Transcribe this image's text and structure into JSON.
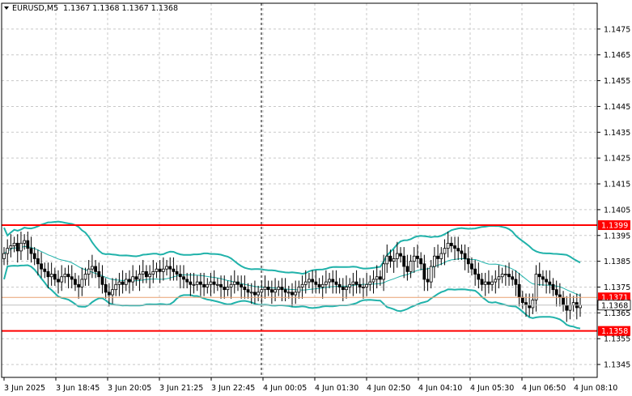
{
  "header": {
    "symbol": "EURUSD,M5",
    "ohlc": "1.1367 1.1368 1.1367 1.1368"
  },
  "colors": {
    "background": "#ffffff",
    "grid": "#c8c8c8",
    "axis": "#000000",
    "candle": "#000000",
    "bands": "#20b2aa",
    "level_line": "#ff0000",
    "bid_line": "#e8a070",
    "tag_red": "#ff0000"
  },
  "chart_data": {
    "type": "candlestick",
    "title": "EURUSD,M5",
    "ylim": [
      1.134,
      1.1485
    ],
    "y_ticks": [
      "1.1475",
      "1.1465",
      "1.1455",
      "1.1445",
      "1.1435",
      "1.1425",
      "1.1415",
      "1.1405",
      "1.1395",
      "1.1385",
      "1.1375",
      "1.1365",
      "1.1355",
      "1.1345"
    ],
    "x_ticks": [
      "3 Jun 2025",
      "3 Jun 18:45",
      "3 Jun 20:05",
      "3 Jun 21:25",
      "3 Jun 22:45",
      "4 Jun 00:05",
      "4 Jun 01:30",
      "4 Jun 02:50",
      "4 Jun 04:10",
      "4 Jun 05:30",
      "4 Jun 06:50",
      "4 Jun 08:10"
    ],
    "session_separator": "4 Jun 00:05",
    "levels": [
      {
        "label": "1.1399",
        "value": 1.1399
      },
      {
        "label": "1.1358",
        "value": 1.1358
      }
    ],
    "price_tags": [
      {
        "label": "1.1371",
        "value": 1.1371
      },
      {
        "label": "1.1368",
        "value": 1.1368
      }
    ],
    "close": [
      1.1388,
      1.139,
      1.1391,
      1.1392,
      1.1389,
      1.1392,
      1.1393,
      1.139,
      1.1388,
      1.1386,
      1.1384,
      1.1382,
      1.1381,
      1.1379,
      1.138,
      1.1378,
      1.1377,
      1.1379,
      1.138,
      1.1379,
      1.1378,
      1.1376,
      1.1375,
      1.1378,
      1.138,
      1.1382,
      1.1383,
      1.1381,
      1.1379,
      1.1376,
      1.1373,
      1.1372,
      1.1374,
      1.1376,
      1.1377,
      1.1376,
      1.1378,
      1.1377,
      1.1379,
      1.1378,
      1.138,
      1.1381,
      1.1379,
      1.138,
      1.1381,
      1.1382,
      1.1381,
      1.1382,
      1.1383,
      1.1382,
      1.1381,
      1.138,
      1.1379,
      1.1378,
      1.1377,
      1.1376,
      1.1376,
      1.1377,
      1.1376,
      1.1375,
      1.1376,
      1.1377,
      1.1376,
      1.1376,
      1.1375,
      1.1374,
      1.1375,
      1.1376,
      1.1377,
      1.1376,
      1.1375,
      1.1374,
      1.1373,
      1.1373,
      1.1372,
      1.1373,
      1.1374,
      1.1375,
      1.1374,
      1.1373,
      1.1374,
      1.1375,
      1.1374,
      1.1373,
      1.1373,
      1.1372,
      1.1373,
      1.1375,
      1.1376,
      1.1377,
      1.1378,
      1.1377,
      1.1376,
      1.1375,
      1.1376,
      1.1377,
      1.1378,
      1.1377,
      1.1376,
      1.1375,
      1.1374,
      1.1375,
      1.1376,
      1.1377,
      1.1376,
      1.1375,
      1.1375,
      1.1376,
      1.1377,
      1.1378,
      1.1379,
      1.1378,
      1.1384,
      1.1387,
      1.1385,
      1.1386,
      1.1388,
      1.1387,
      1.1383,
      1.1381,
      1.1385,
      1.1387,
      1.1386,
      1.1384,
      1.1378,
      1.1377,
      1.1383,
      1.1387,
      1.1386,
      1.1388,
      1.139,
      1.1392,
      1.1391,
      1.139,
      1.1389,
      1.1388,
      1.1386,
      1.1384,
      1.1382,
      1.138,
      1.1378,
      1.1376,
      1.1377,
      1.1376,
      1.1377,
      1.1378,
      1.1379,
      1.138,
      1.138,
      1.1379,
      1.1378,
      1.1376,
      1.1371,
      1.1369,
      1.1368,
      1.1367,
      1.137,
      1.138,
      1.1379,
      1.1378,
      1.1377,
      1.1376,
      1.1374,
      1.1372,
      1.1371,
      1.1368,
      1.1366,
      1.1368,
      1.1369,
      1.1367,
      1.1368
    ]
  }
}
